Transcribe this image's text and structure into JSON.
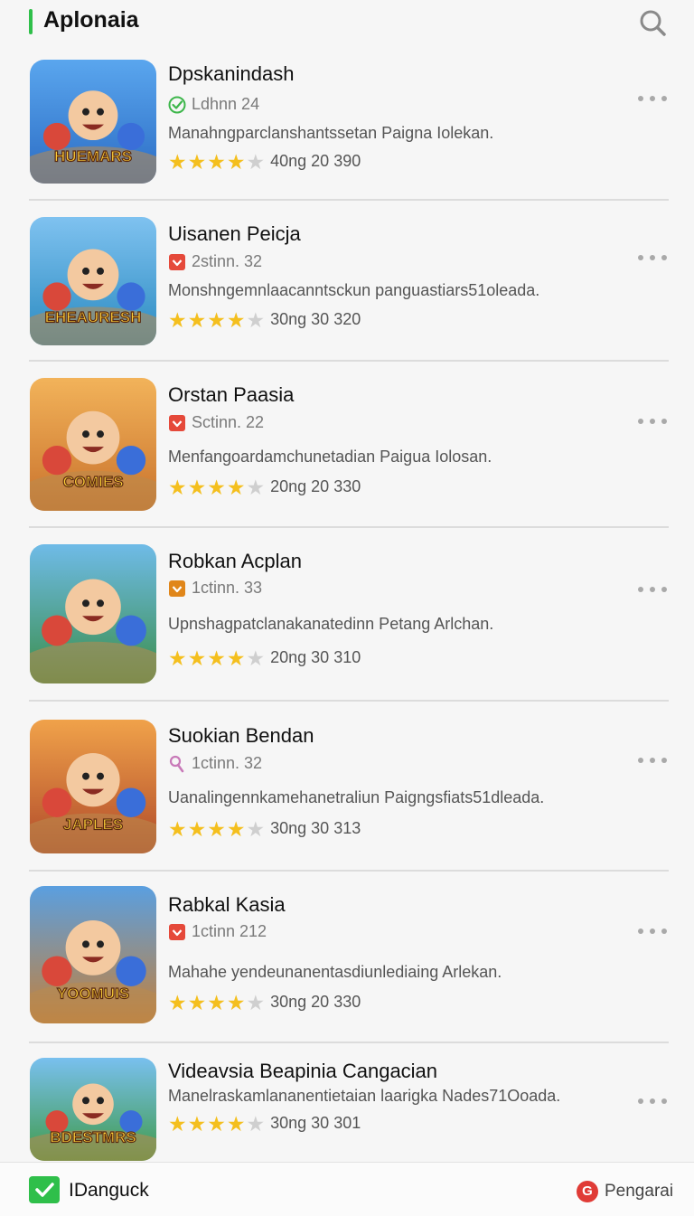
{
  "header": {
    "title": "Aplonaia",
    "search_icon": "search-icon"
  },
  "apps": [
    {
      "name": "Dpskanindash",
      "meta": "Ldhnn 24",
      "meta_icon": "check-badge-icon",
      "meta_color": "#3cb64a",
      "description": "Manahngparclanshantssetan Paigna Iolekan.",
      "stars": 4,
      "rating": "40ng 20 390",
      "thumb_text": "HUEMARS",
      "thumb_colors": [
        "#5aa6ee",
        "#2b6cc4"
      ]
    },
    {
      "name": "Uisanen Peicja",
      "meta": "2stinn. 32",
      "meta_icon": "flag-icon",
      "meta_color": "#e5493a",
      "description": "Monshngemnlaacanntsckun panguastiars51oleada.",
      "stars": 4,
      "rating": "30ng 30 320",
      "thumb_text": "EHEAURESH",
      "thumb_colors": [
        "#7fc2f0",
        "#2a8ac0"
      ]
    },
    {
      "name": "Orstan Paasia",
      "meta": "Sctinn. 22",
      "meta_icon": "flag-icon",
      "meta_color": "#e5493a",
      "description": "Menfangoardamchunetadian Paigua Iolosan.",
      "stars": 4,
      "rating": "20ng 20 330",
      "thumb_text": "COMIES",
      "thumb_colors": [
        "#f2b35a",
        "#c9722c"
      ]
    },
    {
      "name": "Robkan Acplan",
      "meta": "1ctinn. 33",
      "meta_icon": "flag-icon",
      "meta_color": "#e0861a",
      "description": "Upnshagpatclanakanatedinn Petang Arlchan.",
      "stars": 4,
      "rating": "20ng 30 310",
      "thumb_text": "",
      "thumb_colors": [
        "#6fbbe8",
        "#3a8e4a"
      ]
    },
    {
      "name": "Suokian Bendan",
      "meta": "1ctinn. 32",
      "meta_icon": "pin-icon",
      "meta_color": "#c879b8",
      "description": "Uanalingennkamehanetraliun Paigngsfiats51dleada.",
      "stars": 4,
      "rating": "30ng 30 313",
      "thumb_text": "JAPLES",
      "thumb_colors": [
        "#f0a24a",
        "#b04a2a"
      ]
    },
    {
      "name": "Rabkal Kasia",
      "meta": "1ctinn 212",
      "meta_icon": "flag-icon",
      "meta_color": "#e5493a",
      "description": "Mahahe yendeunanentasdiunlediaing Arlekan.",
      "stars": 4,
      "rating": "30ng 20 330",
      "thumb_text": "YOOMUIS",
      "thumb_colors": [
        "#5a9fe0",
        "#c4803a"
      ]
    },
    {
      "name": "Videavsia Beapinia Cangacian",
      "meta": "",
      "meta_icon": "",
      "meta_color": "#e5493a",
      "description": "Manelraskamlananentietaian laarigka Nades71Ooada.",
      "stars": 4,
      "rating": "30ng 30 301",
      "thumb_text": "BDESTMRS",
      "thumb_colors": [
        "#79c0ef",
        "#3f9a48"
      ]
    }
  ],
  "bottom_bar": {
    "left_label": "IDanguck",
    "right_label": "Pengarai",
    "right_glyph": "G"
  },
  "colors": {
    "accent_green": "#2fbf4a",
    "star_yellow": "#f4bf1e",
    "star_grey": "#cfcfcf"
  }
}
